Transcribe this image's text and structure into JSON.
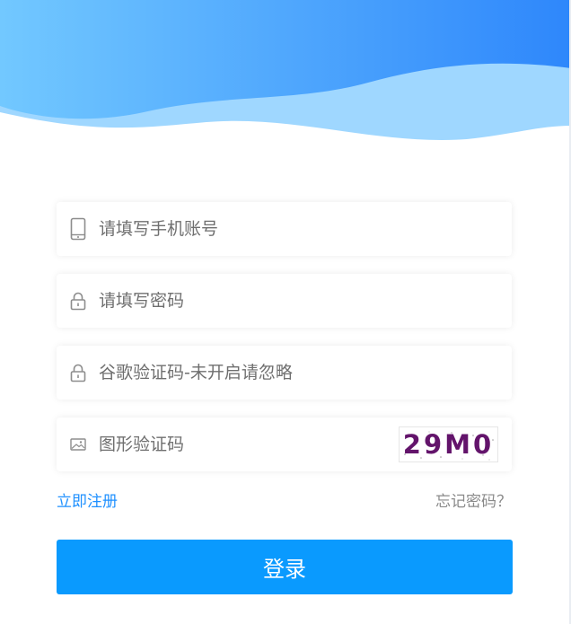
{
  "header": {
    "wave_colors": {
      "top_start": "#72c8ff",
      "top_end": "#2e87fb",
      "lower": "#9fd7ff"
    }
  },
  "form": {
    "phone": {
      "placeholder": "请填写手机账号",
      "icon": "phone-icon"
    },
    "password": {
      "placeholder": "请填写密码",
      "icon": "lock-icon"
    },
    "google_code": {
      "placeholder": "谷歌验证码-未开启请忽略",
      "icon": "lock-icon"
    },
    "captcha": {
      "placeholder": "图形验证码",
      "icon": "image-icon",
      "code": "29M0",
      "code_color": "#63146b"
    }
  },
  "links": {
    "register": "立即注册",
    "forgot": "忘记密码？"
  },
  "login_button": {
    "label": "登录",
    "color": "#0a9afe"
  }
}
